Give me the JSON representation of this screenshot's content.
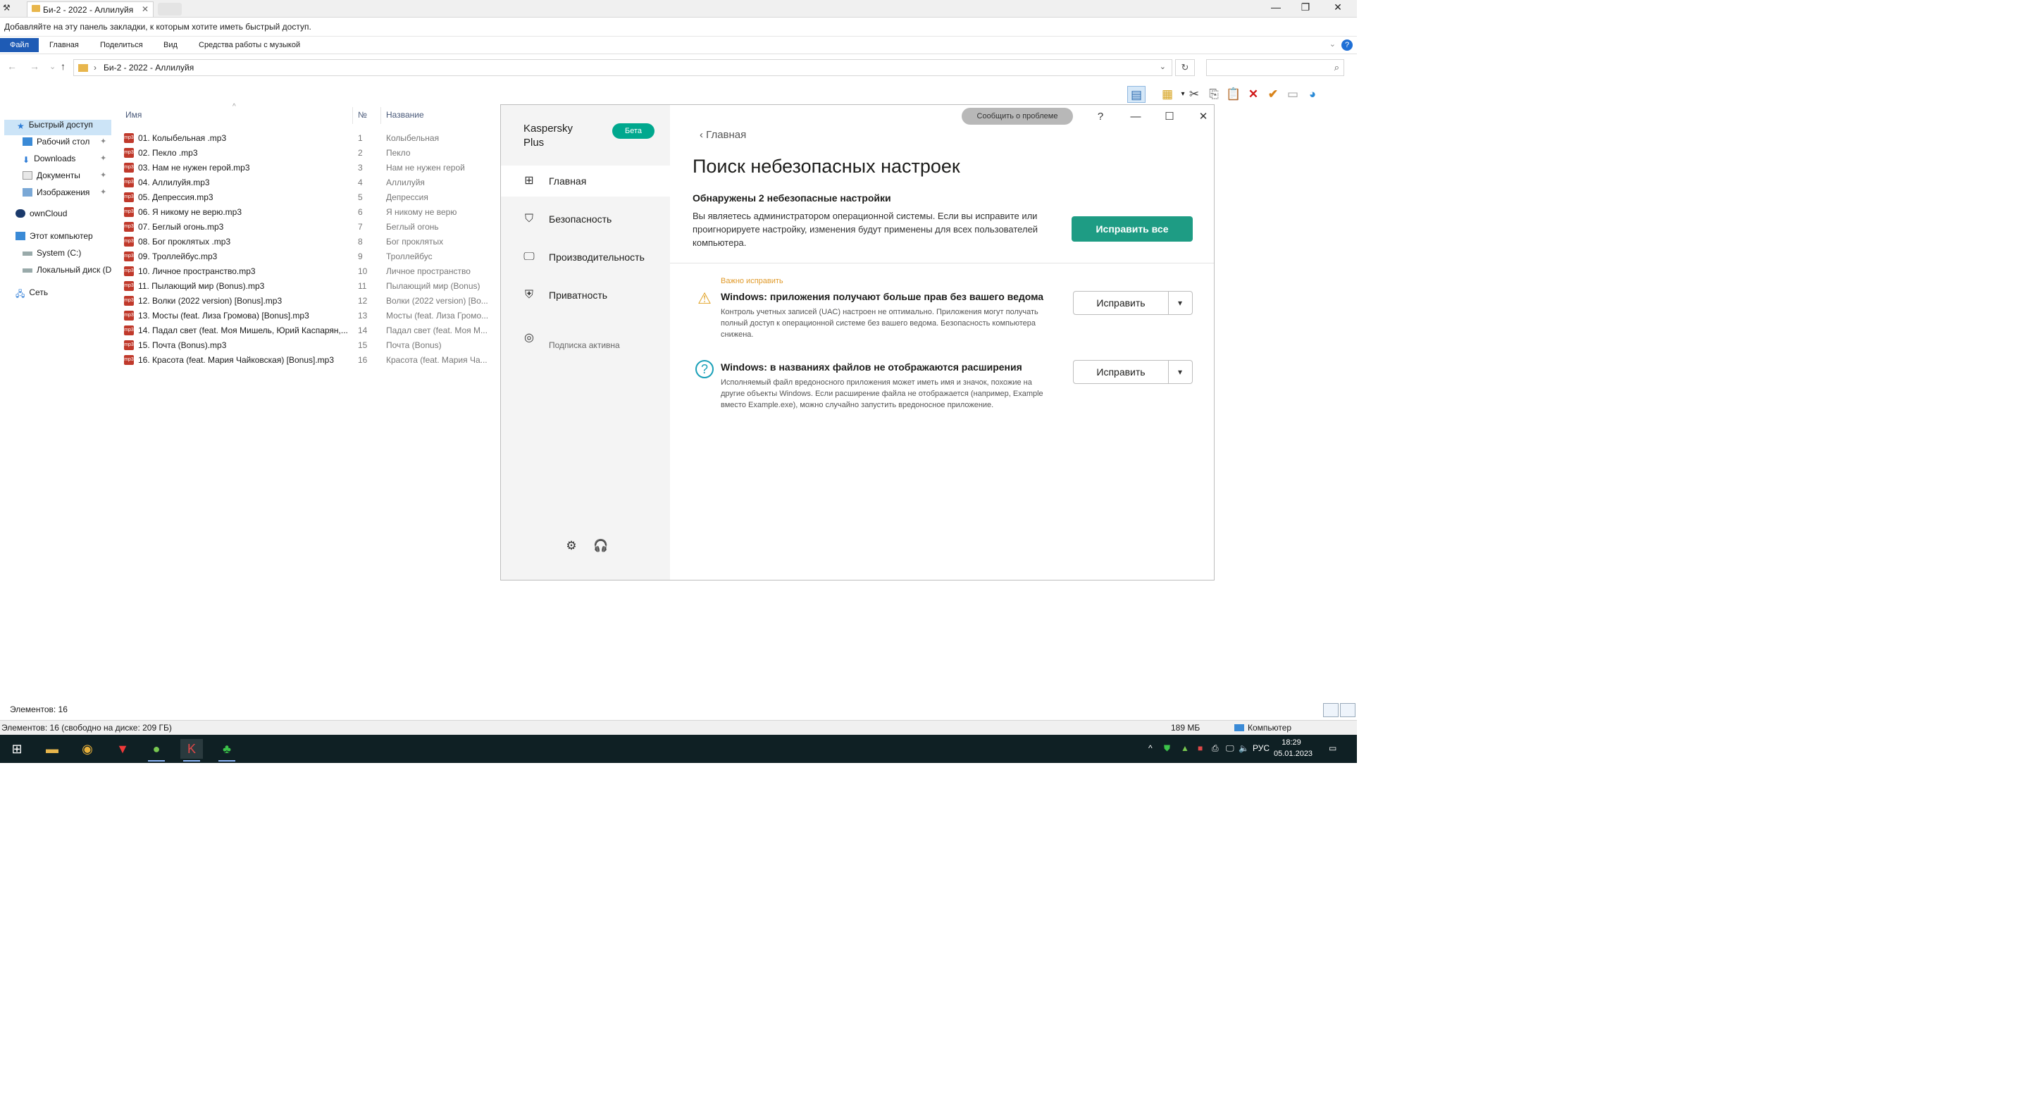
{
  "explorer": {
    "tab_title": "Би-2 - 2022 - Аллилуйя",
    "tab_close": "✕",
    "bookmark_hint": "Добавляйте на эту панель закладки, к которым хотите иметь быстрый доступ.",
    "ribbon_tabs": [
      "Файл",
      "Главная",
      "Поделиться",
      "Вид",
      "Средства работы с музыкой"
    ],
    "address_path": "Би-2 - 2022 - Аллилуйя",
    "search_placeholder": "",
    "columns": {
      "name": "Имя",
      "num": "№",
      "title": "Название"
    },
    "nav": [
      {
        "label": "Быстрый доступ",
        "icon": "star-icon"
      },
      {
        "label": "Рабочий стол",
        "icon": "desktop-icon",
        "pinned": true
      },
      {
        "label": "Downloads",
        "icon": "download-icon",
        "pinned": true
      },
      {
        "label": "Документы",
        "icon": "document-icon",
        "pinned": true
      },
      {
        "label": "Изображения",
        "icon": "image-icon",
        "pinned": true
      },
      {
        "label": "ownCloud",
        "icon": "cloud-icon"
      },
      {
        "label": "Этот компьютер",
        "icon": "computer-icon"
      },
      {
        "label": "System (C:)",
        "icon": "drive-icon"
      },
      {
        "label": "Локальный диск (D",
        "icon": "drive-icon"
      },
      {
        "label": "Сеть",
        "icon": "network-icon"
      }
    ],
    "files": [
      {
        "name": "01. Колыбельная .mp3",
        "num": "1",
        "title": "Колыбельная"
      },
      {
        "name": "02. Пекло .mp3",
        "num": "2",
        "title": "Пекло"
      },
      {
        "name": "03. Нам не нужен герой.mp3",
        "num": "3",
        "title": "Нам не нужен герой"
      },
      {
        "name": "04. Аллилуйя.mp3",
        "num": "4",
        "title": "Аллилуйя"
      },
      {
        "name": "05. Депрессия.mp3",
        "num": "5",
        "title": "Депрессия"
      },
      {
        "name": "06. Я никому не верю.mp3",
        "num": "6",
        "title": "Я никому не верю"
      },
      {
        "name": "07. Беглый огонь.mp3",
        "num": "7",
        "title": "Беглый огонь"
      },
      {
        "name": "08. Бог проклятых .mp3",
        "num": "8",
        "title": "Бог проклятых"
      },
      {
        "name": "09. Троллейбус.mp3",
        "num": "9",
        "title": "Троллейбус"
      },
      {
        "name": "10. Личное пространство.mp3",
        "num": "10",
        "title": "Личное пространство"
      },
      {
        "name": "11. Пылающий мир (Bonus).mp3",
        "num": "11",
        "title": "Пылающий мир (Bonus)"
      },
      {
        "name": "12. Волки (2022 version) [Bonus].mp3",
        "num": "12",
        "title": "Волки (2022 version) [Bo..."
      },
      {
        "name": "13. Мосты (feat. Лиза Громова) [Bonus].mp3",
        "num": "13",
        "title": "Мосты (feat. Лиза Громо..."
      },
      {
        "name": "14. Падал свет (feat. Моя Мишель, Юрий Каспарян,...",
        "num": "14",
        "title": "Падал свет (feat. Моя M..."
      },
      {
        "name": "15. Почта (Bonus).mp3",
        "num": "15",
        "title": "Почта (Bonus)"
      },
      {
        "name": "16. Красота (feat. Мария Чайковская) [Bonus].mp3",
        "num": "16",
        "title": "Красота (feat. Мария Ча..."
      }
    ],
    "file_badge": "mp3",
    "items_count": "Элементов: 16",
    "status_left": "Элементов: 16 (свободно на диске: 209 ГБ)",
    "status_size": "189 МБ",
    "status_location": "Компьютер"
  },
  "taskbar": {
    "lang": "РУС",
    "time": "18:29",
    "date": "05.01.2023",
    "apps": [
      "windows-start-icon",
      "file-explorer-icon",
      "chrome-icon",
      "vivaldi-icon",
      "utorrent-icon",
      "kaspersky-icon",
      "clover-icon"
    ]
  },
  "kaspersky": {
    "brand_line1": "Kaspersky",
    "brand_line2": "Plus",
    "beta_badge": "Бета",
    "nav": [
      {
        "label": "Главная",
        "icon": "home-grid-icon"
      },
      {
        "label": "Безопасность",
        "icon": "shield-icon"
      },
      {
        "label": "Производительность",
        "icon": "monitor-icon"
      },
      {
        "label": "Приватность",
        "icon": "privacy-icon"
      }
    ],
    "subscription": "Подписка активна",
    "report_button": "Сообщить о проблеме",
    "back_label": "Главная",
    "title": "Поиск небезопасных настроек",
    "found": "Обнаружены 2 небезопасные настройки",
    "description": "Вы являетесь администратором операционной системы. Если вы исправите или проигнорируете настройку, изменения будут применены для всех пользователей компьютера.",
    "fix_all": "Исправить все",
    "issues": [
      {
        "tag": "Важно исправить",
        "title": "Windows: приложения получают больше прав без вашего ведома",
        "desc": "Контроль учетных записей (UAC) настроен не оптимально. Приложения могут получать полный доступ к операционной системе без вашего ведома. Безопасность компьютера снижена.",
        "button": "Исправить",
        "icon": "warning-icon"
      },
      {
        "tag": "",
        "title": "Windows: в названиях файлов не отображаются расширения",
        "desc": "Исполняемый файл вредоносного приложения может иметь имя и значок, похожие на другие объекты Windows. Если расширение файла не отображается (например, Example вместо Example.exe), можно случайно запустить вредоносное приложение.",
        "button": "Исправить",
        "icon": "question-icon"
      }
    ]
  }
}
